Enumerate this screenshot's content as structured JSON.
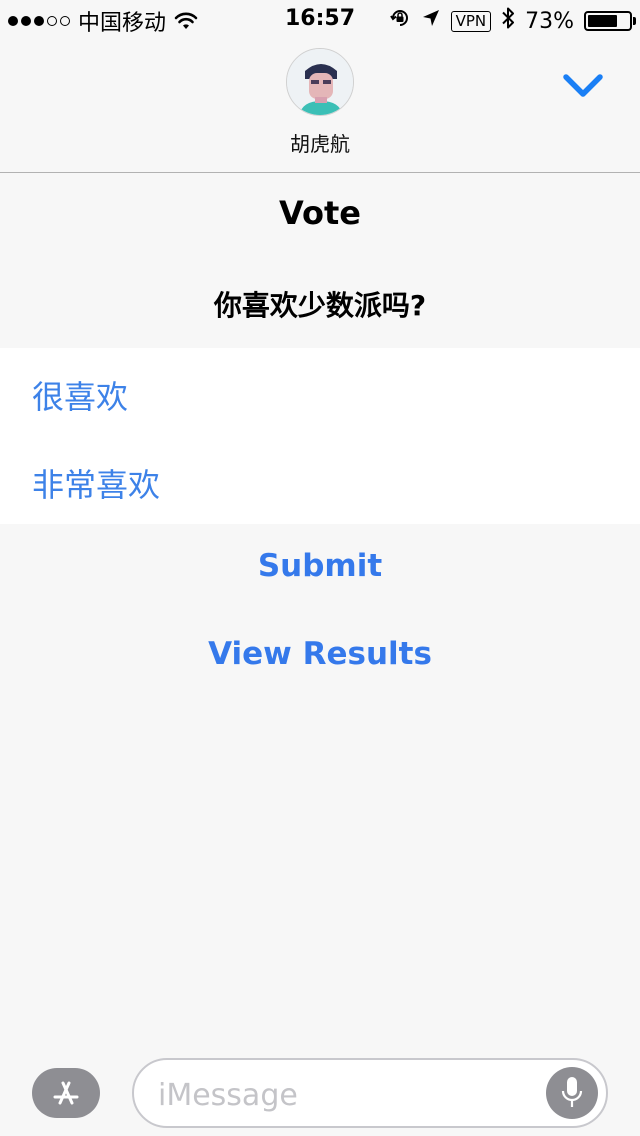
{
  "status_bar": {
    "carrier": "中国移动",
    "time": "16:57",
    "vpn": "VPN",
    "battery_percent": "73%",
    "battery_level": 0.73,
    "signal_bars": 3,
    "signal_total": 5,
    "icons": [
      "wifi-icon",
      "rotation-lock-icon",
      "location-arrow-icon",
      "bluetooth-icon",
      "battery-icon"
    ]
  },
  "header": {
    "contact_name": "胡虎航",
    "collapse_icon": "chevron-down-icon"
  },
  "vote": {
    "title": "Vote",
    "question": "你喜欢少数派吗?",
    "options": [
      {
        "label": "很喜欢"
      },
      {
        "label": "非常喜欢"
      }
    ],
    "submit_label": "Submit",
    "view_results_label": "View Results"
  },
  "input_bar": {
    "app_store_icon": "app-store-icon",
    "placeholder": "iMessage",
    "mic_icon": "microphone-icon"
  },
  "colors": {
    "accent": "#3579eb",
    "option_text": "#3d82e8",
    "background": "#f7f7f7",
    "chevron": "#1a7ff5"
  }
}
